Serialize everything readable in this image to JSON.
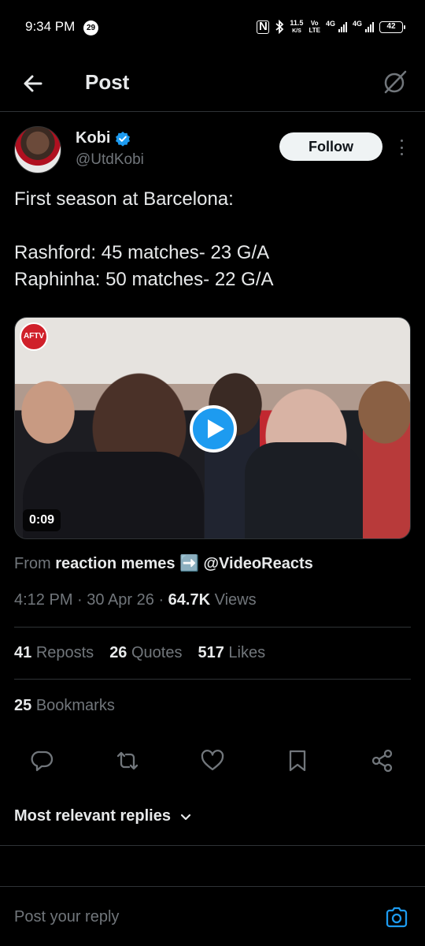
{
  "status_bar": {
    "time": "9:34 PM",
    "notification_count": "29",
    "net_speed": "11.5",
    "net_speed_unit": "K/S",
    "volte": "Vo\nLTE",
    "network_1": "4G",
    "network_2": "4G",
    "battery": "42"
  },
  "header": {
    "title": "Post"
  },
  "post": {
    "author_name": "Kobi",
    "author_handle": "@UtdKobi",
    "follow_label": "Follow",
    "text": "First season at Barcelona:\n\nRashford:  45 matches- 23 G/A\nRaphinha: 50 matches- 22 G/A",
    "media": {
      "logo_text": "AFTV",
      "duration": "0:09"
    },
    "source_prefix": "From",
    "source_name": "reaction memes ➡️ @VideoReacts",
    "time": "4:12 PM",
    "date": "30 Apr 26",
    "views_count": "64.7K",
    "views_label": "Views",
    "reposts_count": "41",
    "reposts_label": "Reposts",
    "quotes_count": "26",
    "quotes_label": "Quotes",
    "likes_count": "517",
    "likes_label": "Likes",
    "bookmarks_count": "25",
    "bookmarks_label": "Bookmarks"
  },
  "replies": {
    "sort_label": "Most relevant replies"
  },
  "reply_bar": {
    "placeholder": "Post your reply"
  },
  "colors": {
    "background": "#000000",
    "text": "#e7e9ea",
    "muted": "#71767b",
    "accent": "#1d9bf0",
    "divider": "#2f3336"
  },
  "icons": [
    "back-arrow-icon",
    "grok-icon",
    "verified-icon",
    "more-icon",
    "play-icon",
    "reply-icon",
    "repost-icon",
    "like-icon",
    "bookmark-icon",
    "share-icon",
    "chevron-down-icon",
    "camera-icon"
  ]
}
